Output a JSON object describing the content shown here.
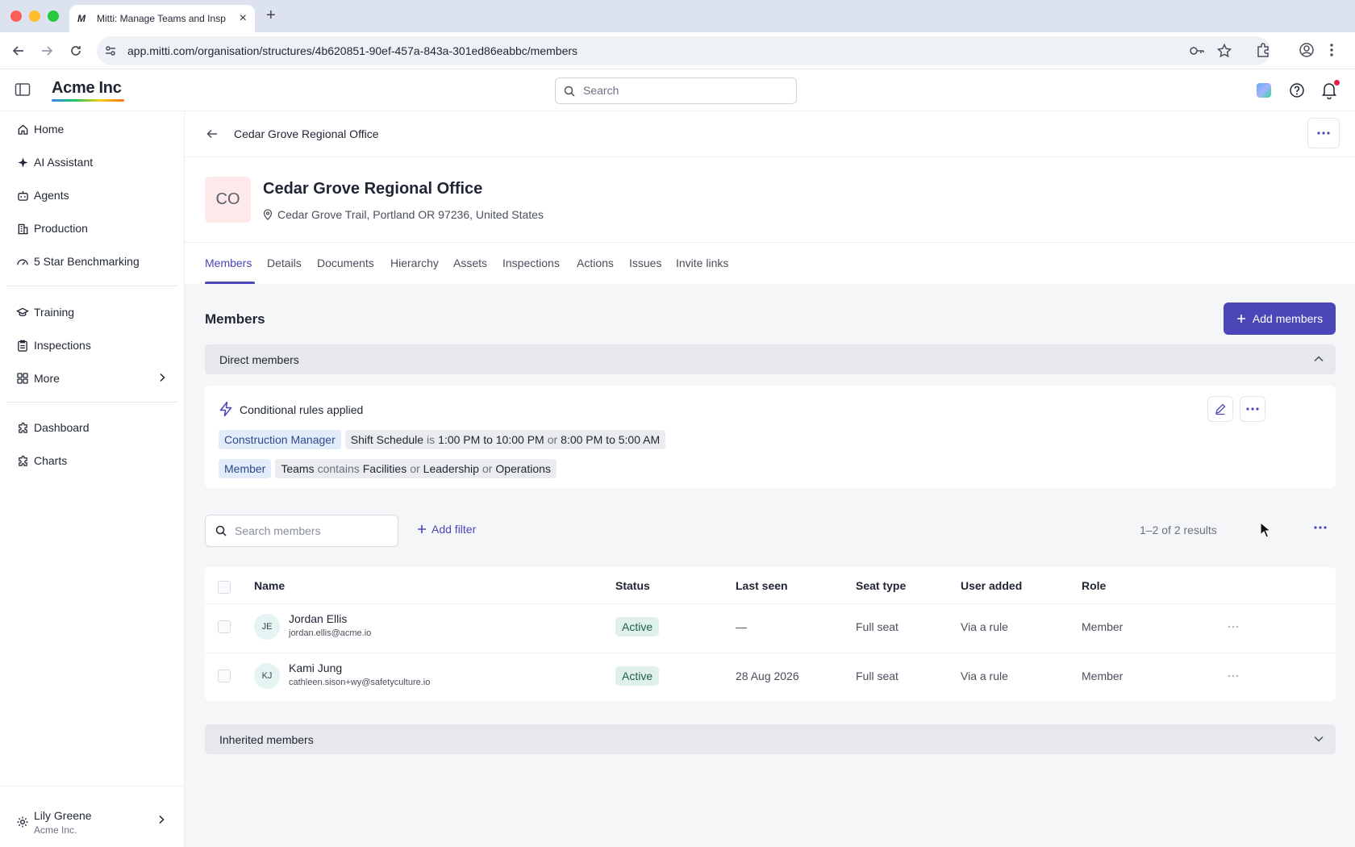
{
  "browser": {
    "tab_title": "Mitti: Manage Teams and Insp",
    "tab_favicon": "M",
    "new_tab": "+",
    "url": "app.mitti.com/organisation/structures/4b620851-90ef-457a-843a-301ed86eabbc/members"
  },
  "topbar": {
    "logo": "Acme Inc",
    "search_placeholder": "Search"
  },
  "sidebar": {
    "items": [
      {
        "label": "Home",
        "icon": "home-icon"
      },
      {
        "label": "AI Assistant",
        "icon": "sparkle-icon"
      },
      {
        "label": "Agents",
        "icon": "robot-icon"
      },
      {
        "label": "Production",
        "icon": "building-icon"
      },
      {
        "label": "5 Star Benchmarking",
        "icon": "gauge-icon"
      },
      {
        "label": "Training",
        "icon": "graduation-cap-icon"
      },
      {
        "label": "Inspections",
        "icon": "clipboard-icon"
      },
      {
        "label": "More",
        "icon": "grid-icon"
      },
      {
        "label": "Dashboard",
        "icon": "puzzle-icon"
      },
      {
        "label": "Charts",
        "icon": "puzzle-icon"
      }
    ],
    "user": {
      "name": "Lily Greene",
      "org": "Acme Inc."
    }
  },
  "page": {
    "breadcrumb": "Cedar Grove Regional Office",
    "org_initials": "CO",
    "org_name": "Cedar Grove Regional Office",
    "address": "Cedar Grove Trail, Portland OR 97236, United States",
    "tabs": [
      "Members",
      "Details",
      "Documents",
      "Hierarchy",
      "Assets",
      "Inspections",
      "Actions",
      "Issues",
      "Invite links"
    ],
    "active_tab": "Members"
  },
  "members": {
    "title": "Members",
    "add_button": "Add members",
    "direct_section": "Direct members",
    "inherited_section": "Inherited members",
    "rules": {
      "title": "Conditional rules applied",
      "rule1": {
        "role": "Construction Manager",
        "field": "Shift Schedule",
        "op": "is",
        "v1": "1:00 PM to 10:00 PM",
        "or": "or",
        "v2": "8:00 PM to 5:00 AM"
      },
      "rule2": {
        "role": "Member",
        "field": "Teams",
        "op": "contains",
        "v1": "Facilities",
        "or1": "or",
        "v2": "Leadership",
        "or2": "or",
        "v3": "Operations"
      }
    },
    "search_placeholder": "Search members",
    "add_filter": "Add filter",
    "results": "1–2 of 2 results",
    "columns": {
      "name": "Name",
      "status": "Status",
      "last_seen": "Last seen",
      "seat_type": "Seat type",
      "user_added": "User added",
      "role": "Role"
    },
    "rows": [
      {
        "initials": "JE",
        "name": "Jordan Ellis",
        "email": "jordan.ellis@acme.io",
        "status": "Active",
        "last_seen": "—",
        "seat_type": "Full seat",
        "user_added": "Via a rule",
        "role": "Member"
      },
      {
        "initials": "KJ",
        "name": "Kami Jung",
        "email": "cathleen.sison+wy@safetyculture.io",
        "status": "Active",
        "last_seen": "28 Aug 2026",
        "seat_type": "Full seat",
        "user_added": "Via a rule",
        "role": "Member"
      }
    ]
  },
  "colors": {
    "accent": "#4b47b9",
    "status_active_bg": "#dff1ea",
    "role_chip_bg": "#e3ecfb"
  }
}
